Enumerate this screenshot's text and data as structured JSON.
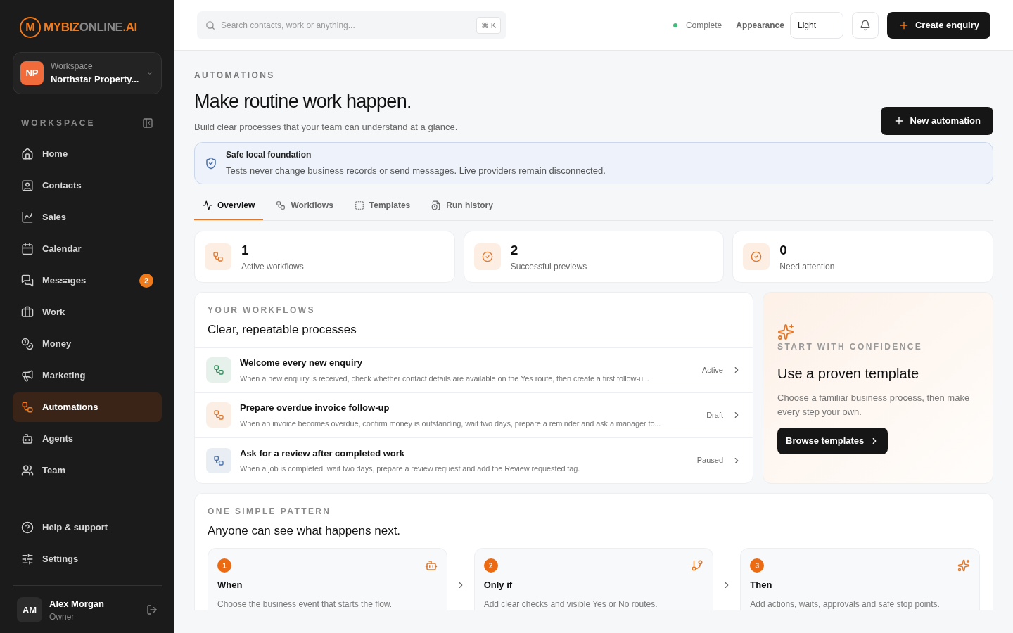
{
  "brand": {
    "mark": "M",
    "parts": [
      {
        "text": "MYBIZ",
        "color": "#f07a1a"
      },
      {
        "text": "ONLINE",
        "color": "#8a8a8a"
      },
      {
        "text": ".AI",
        "color": "#f07a1a"
      }
    ]
  },
  "workspace": {
    "initials": "NP",
    "label": "Workspace",
    "name": "Northstar Property..."
  },
  "sidebar": {
    "heading": "WORKSPACE",
    "items": [
      {
        "label": "Home",
        "selected": false
      },
      {
        "label": "Contacts",
        "selected": false
      },
      {
        "label": "Sales",
        "selected": false
      },
      {
        "label": "Calendar",
        "selected": false
      },
      {
        "label": "Messages",
        "selected": false,
        "badge": "2"
      },
      {
        "label": "Work",
        "selected": false
      },
      {
        "label": "Money",
        "selected": false
      },
      {
        "label": "Marketing",
        "selected": false
      },
      {
        "label": "Automations",
        "selected": true
      },
      {
        "label": "Agents",
        "selected": false
      },
      {
        "label": "Team",
        "selected": false
      }
    ],
    "footer_items": [
      {
        "label": "Help & support"
      },
      {
        "label": "Settings"
      }
    ],
    "user": {
      "initials": "AM",
      "name": "Alex Morgan",
      "role": "Owner"
    }
  },
  "topbar": {
    "search": {
      "placeholder": "Search contacts, work or anything...",
      "shortcut": "⌘ K"
    },
    "status": "Complete",
    "appearance_label": "Appearance",
    "appearance_value": "Light",
    "create_button": "Create enquiry"
  },
  "page": {
    "eyebrow": "AUTOMATIONS",
    "title": "Make routine work happen.",
    "subtitle": "Build clear processes that your team can understand at a glance.",
    "new_button": "New automation",
    "notice": {
      "title": "Safe local foundation",
      "text": "Tests never change business records or send messages. Live providers remain disconnected."
    },
    "tabs": [
      {
        "label": "Overview",
        "selected": true
      },
      {
        "label": "Workflows",
        "selected": false
      },
      {
        "label": "Templates",
        "selected": false
      },
      {
        "label": "Run history",
        "selected": false
      }
    ],
    "stats": [
      {
        "value": "1",
        "label": "Active workflows"
      },
      {
        "value": "2",
        "label": "Successful previews"
      },
      {
        "value": "0",
        "label": "Need attention"
      }
    ],
    "workflows": {
      "eyebrow": "YOUR WORKFLOWS",
      "title": "Clear, repeatable processes",
      "items": [
        {
          "name": "Welcome every new enquiry",
          "description": "When a new enquiry is received, check whether contact details are available on the Yes route, then create a first follow-u...",
          "status": "Active",
          "color": "#2f8f5b"
        },
        {
          "name": "Prepare overdue invoice follow-up",
          "description": "When an invoice becomes overdue, confirm money is outstanding, wait two days, prepare a reminder and ask a manager to...",
          "status": "Draft",
          "color": "#e0772a"
        },
        {
          "name": "Ask for a review after completed work",
          "description": "When a job is completed, wait two days, prepare a review request and add the Review requested tag.",
          "status": "Paused",
          "color": "#4a6fa5"
        }
      ]
    },
    "template_card": {
      "eyebrow": "START WITH CONFIDENCE",
      "title": "Use a proven template",
      "text": "Choose a familiar business process, then make every step your own.",
      "button": "Browse templates"
    },
    "pattern": {
      "eyebrow": "ONE SIMPLE PATTERN",
      "title": "Anyone can see what happens next.",
      "steps": [
        {
          "number": "1",
          "title": "When",
          "text": "Choose the business event that starts the flow."
        },
        {
          "number": "2",
          "title": "Only if",
          "text": "Add clear checks and visible Yes or No routes."
        },
        {
          "number": "3",
          "title": "Then",
          "text": "Add actions, waits, approvals and safe stop points."
        }
      ]
    }
  }
}
